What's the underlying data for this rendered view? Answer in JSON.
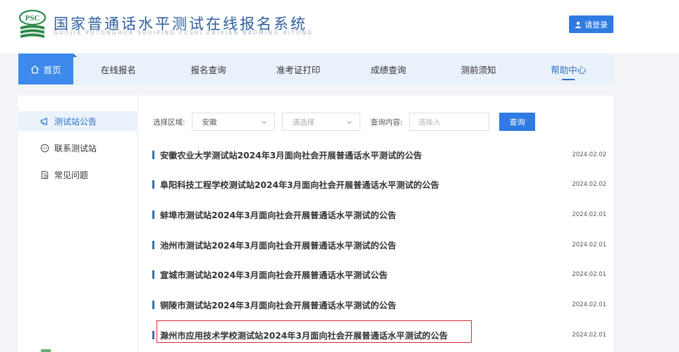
{
  "header": {
    "logo_text": "PSC",
    "title": "国家普通话水平测试在线报名系统",
    "subtitle": "GUOJIA PUTONGHUA SHUIPING CESHI ZAIXIAN BAOMING XITONG",
    "login_label": "请登录"
  },
  "nav": {
    "items": [
      {
        "label": "首页"
      },
      {
        "label": "在线报名"
      },
      {
        "label": "报名查询"
      },
      {
        "label": "准考证打印"
      },
      {
        "label": "成绩查询"
      },
      {
        "label": "测前须知"
      },
      {
        "label": "帮助中心"
      }
    ]
  },
  "sidebar": {
    "items": [
      {
        "label": "测试站公告"
      },
      {
        "label": "联系测试站"
      },
      {
        "label": "常见问题"
      }
    ]
  },
  "filter": {
    "region_label": "选择区域:",
    "region_value": "安徽",
    "city_placeholder": "请选择",
    "query_label": "查询内容:",
    "query_placeholder": "请输入",
    "query_button": "查询"
  },
  "announcements": [
    {
      "title": "安徽农业大学测试站2024年3月面向社会开展普通话水平测试的公告",
      "date": "2024.02.02"
    },
    {
      "title": "阜阳科技工程学校测试站2024年3月面向社会开展普通话水平测试的公告",
      "date": "2024.02.02"
    },
    {
      "title": "蚌埠市测试站2024年3月面向社会开展普通话水平测试的公告",
      "date": "2024.02.01"
    },
    {
      "title": "池州市测试站2024年3月面向社会开展普通话水平测试的公告",
      "date": "2024.02.01"
    },
    {
      "title": "宣城市测试站2024年3月面向社会开展普通话水平测试公告",
      "date": "2024.02.01"
    },
    {
      "title": "铜陵市测试站2024年3月面向社会开展普通话水平测试的公告",
      "date": "2024.02.01"
    },
    {
      "title": "滁州市应用技术学校测试站2024年3月面向社会开展普通话水平测试的公告",
      "date": "2024.02.01"
    }
  ],
  "colors": {
    "accent": "#2f7be3",
    "nav_bg": "#e9f1fb",
    "highlight": "#d9292f"
  }
}
